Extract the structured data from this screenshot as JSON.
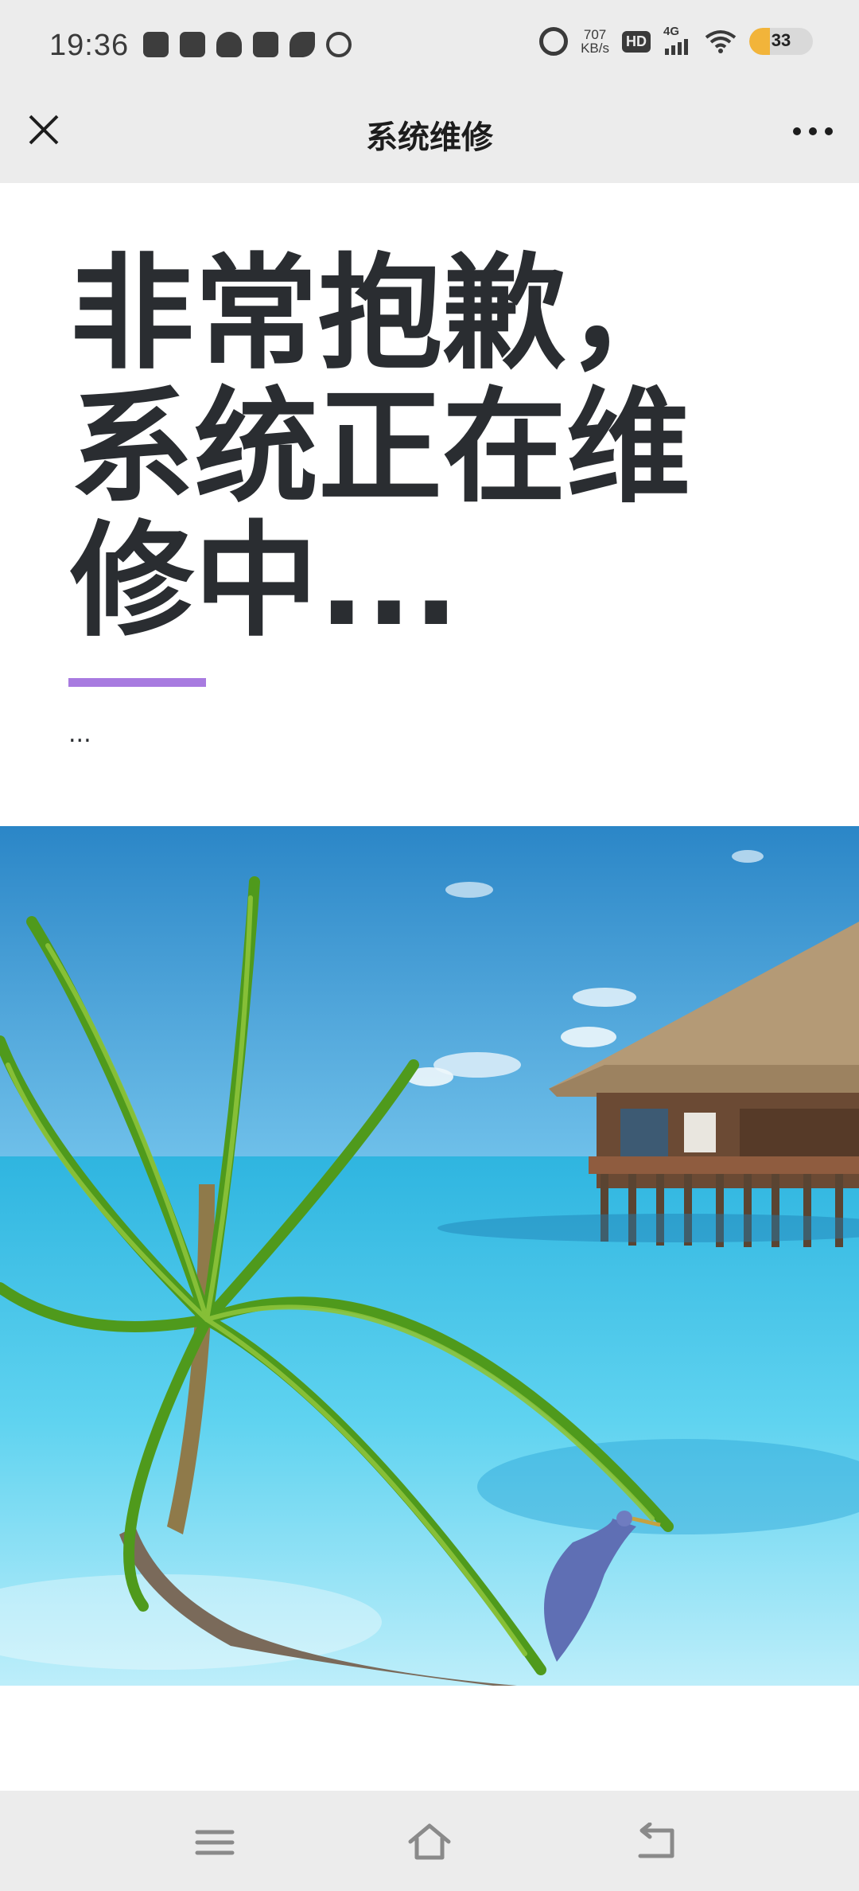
{
  "status_bar": {
    "time": "19:36",
    "left_icons": [
      "gamepad-icon",
      "calendar-icon",
      "cloud-icon",
      "mail-icon",
      "leaf-icon",
      "app-icon"
    ],
    "net_speed_value": "707",
    "net_speed_unit": "KB/s",
    "hd_label": "HD",
    "network_label": "4G",
    "battery_level": "33",
    "battery_fraction": 0.33,
    "battery_color": "#f2b43a"
  },
  "header": {
    "title": "系统维修",
    "close_icon": "close-icon",
    "more_icon": "more-icon"
  },
  "content": {
    "headline": "非常抱歉，系统正在维修中...",
    "accent_color": "#a87be0",
    "body_text": "..."
  },
  "photo": {
    "subject": "tropical-beach-image"
  },
  "system_nav": {
    "menu_icon": "menu-icon",
    "home_icon": "home-icon",
    "back_icon": "back-icon"
  }
}
